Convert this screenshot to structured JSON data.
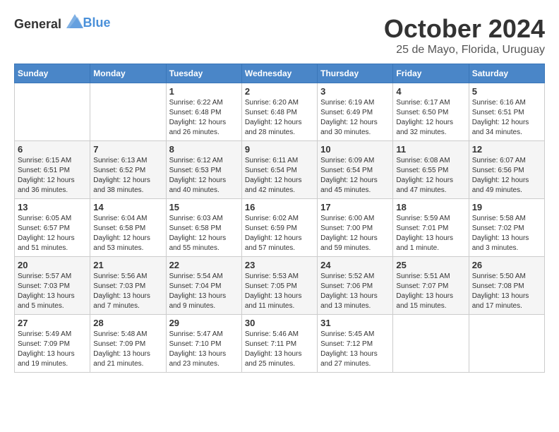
{
  "logo": {
    "text_general": "General",
    "text_blue": "Blue"
  },
  "header": {
    "month_title": "October 2024",
    "subtitle": "25 de Mayo, Florida, Uruguay"
  },
  "days_of_week": [
    "Sunday",
    "Monday",
    "Tuesday",
    "Wednesday",
    "Thursday",
    "Friday",
    "Saturday"
  ],
  "weeks": [
    [
      {
        "day": "",
        "sunrise": "",
        "sunset": "",
        "daylight": ""
      },
      {
        "day": "",
        "sunrise": "",
        "sunset": "",
        "daylight": ""
      },
      {
        "day": "1",
        "sunrise": "Sunrise: 6:22 AM",
        "sunset": "Sunset: 6:48 PM",
        "daylight": "Daylight: 12 hours and 26 minutes."
      },
      {
        "day": "2",
        "sunrise": "Sunrise: 6:20 AM",
        "sunset": "Sunset: 6:48 PM",
        "daylight": "Daylight: 12 hours and 28 minutes."
      },
      {
        "day": "3",
        "sunrise": "Sunrise: 6:19 AM",
        "sunset": "Sunset: 6:49 PM",
        "daylight": "Daylight: 12 hours and 30 minutes."
      },
      {
        "day": "4",
        "sunrise": "Sunrise: 6:17 AM",
        "sunset": "Sunset: 6:50 PM",
        "daylight": "Daylight: 12 hours and 32 minutes."
      },
      {
        "day": "5",
        "sunrise": "Sunrise: 6:16 AM",
        "sunset": "Sunset: 6:51 PM",
        "daylight": "Daylight: 12 hours and 34 minutes."
      }
    ],
    [
      {
        "day": "6",
        "sunrise": "Sunrise: 6:15 AM",
        "sunset": "Sunset: 6:51 PM",
        "daylight": "Daylight: 12 hours and 36 minutes."
      },
      {
        "day": "7",
        "sunrise": "Sunrise: 6:13 AM",
        "sunset": "Sunset: 6:52 PM",
        "daylight": "Daylight: 12 hours and 38 minutes."
      },
      {
        "day": "8",
        "sunrise": "Sunrise: 6:12 AM",
        "sunset": "Sunset: 6:53 PM",
        "daylight": "Daylight: 12 hours and 40 minutes."
      },
      {
        "day": "9",
        "sunrise": "Sunrise: 6:11 AM",
        "sunset": "Sunset: 6:54 PM",
        "daylight": "Daylight: 12 hours and 42 minutes."
      },
      {
        "day": "10",
        "sunrise": "Sunrise: 6:09 AM",
        "sunset": "Sunset: 6:54 PM",
        "daylight": "Daylight: 12 hours and 45 minutes."
      },
      {
        "day": "11",
        "sunrise": "Sunrise: 6:08 AM",
        "sunset": "Sunset: 6:55 PM",
        "daylight": "Daylight: 12 hours and 47 minutes."
      },
      {
        "day": "12",
        "sunrise": "Sunrise: 6:07 AM",
        "sunset": "Sunset: 6:56 PM",
        "daylight": "Daylight: 12 hours and 49 minutes."
      }
    ],
    [
      {
        "day": "13",
        "sunrise": "Sunrise: 6:05 AM",
        "sunset": "Sunset: 6:57 PM",
        "daylight": "Daylight: 12 hours and 51 minutes."
      },
      {
        "day": "14",
        "sunrise": "Sunrise: 6:04 AM",
        "sunset": "Sunset: 6:58 PM",
        "daylight": "Daylight: 12 hours and 53 minutes."
      },
      {
        "day": "15",
        "sunrise": "Sunrise: 6:03 AM",
        "sunset": "Sunset: 6:58 PM",
        "daylight": "Daylight: 12 hours and 55 minutes."
      },
      {
        "day": "16",
        "sunrise": "Sunrise: 6:02 AM",
        "sunset": "Sunset: 6:59 PM",
        "daylight": "Daylight: 12 hours and 57 minutes."
      },
      {
        "day": "17",
        "sunrise": "Sunrise: 6:00 AM",
        "sunset": "Sunset: 7:00 PM",
        "daylight": "Daylight: 12 hours and 59 minutes."
      },
      {
        "day": "18",
        "sunrise": "Sunrise: 5:59 AM",
        "sunset": "Sunset: 7:01 PM",
        "daylight": "Daylight: 13 hours and 1 minute."
      },
      {
        "day": "19",
        "sunrise": "Sunrise: 5:58 AM",
        "sunset": "Sunset: 7:02 PM",
        "daylight": "Daylight: 13 hours and 3 minutes."
      }
    ],
    [
      {
        "day": "20",
        "sunrise": "Sunrise: 5:57 AM",
        "sunset": "Sunset: 7:03 PM",
        "daylight": "Daylight: 13 hours and 5 minutes."
      },
      {
        "day": "21",
        "sunrise": "Sunrise: 5:56 AM",
        "sunset": "Sunset: 7:03 PM",
        "daylight": "Daylight: 13 hours and 7 minutes."
      },
      {
        "day": "22",
        "sunrise": "Sunrise: 5:54 AM",
        "sunset": "Sunset: 7:04 PM",
        "daylight": "Daylight: 13 hours and 9 minutes."
      },
      {
        "day": "23",
        "sunrise": "Sunrise: 5:53 AM",
        "sunset": "Sunset: 7:05 PM",
        "daylight": "Daylight: 13 hours and 11 minutes."
      },
      {
        "day": "24",
        "sunrise": "Sunrise: 5:52 AM",
        "sunset": "Sunset: 7:06 PM",
        "daylight": "Daylight: 13 hours and 13 minutes."
      },
      {
        "day": "25",
        "sunrise": "Sunrise: 5:51 AM",
        "sunset": "Sunset: 7:07 PM",
        "daylight": "Daylight: 13 hours and 15 minutes."
      },
      {
        "day": "26",
        "sunrise": "Sunrise: 5:50 AM",
        "sunset": "Sunset: 7:08 PM",
        "daylight": "Daylight: 13 hours and 17 minutes."
      }
    ],
    [
      {
        "day": "27",
        "sunrise": "Sunrise: 5:49 AM",
        "sunset": "Sunset: 7:09 PM",
        "daylight": "Daylight: 13 hours and 19 minutes."
      },
      {
        "day": "28",
        "sunrise": "Sunrise: 5:48 AM",
        "sunset": "Sunset: 7:09 PM",
        "daylight": "Daylight: 13 hours and 21 minutes."
      },
      {
        "day": "29",
        "sunrise": "Sunrise: 5:47 AM",
        "sunset": "Sunset: 7:10 PM",
        "daylight": "Daylight: 13 hours and 23 minutes."
      },
      {
        "day": "30",
        "sunrise": "Sunrise: 5:46 AM",
        "sunset": "Sunset: 7:11 PM",
        "daylight": "Daylight: 13 hours and 25 minutes."
      },
      {
        "day": "31",
        "sunrise": "Sunrise: 5:45 AM",
        "sunset": "Sunset: 7:12 PM",
        "daylight": "Daylight: 13 hours and 27 minutes."
      },
      {
        "day": "",
        "sunrise": "",
        "sunset": "",
        "daylight": ""
      },
      {
        "day": "",
        "sunrise": "",
        "sunset": "",
        "daylight": ""
      }
    ]
  ]
}
